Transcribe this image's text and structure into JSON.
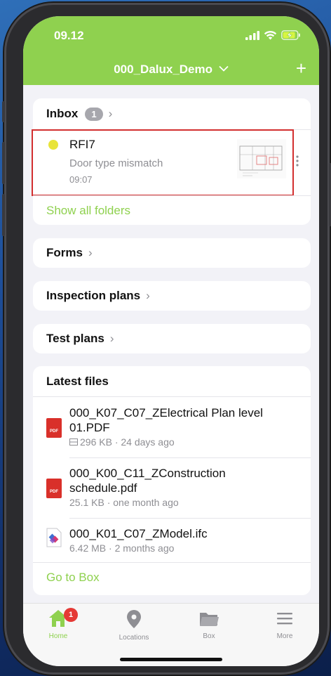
{
  "status": {
    "time": "09.12"
  },
  "header": {
    "project": "000_Dalux_Demo",
    "add_label": "+"
  },
  "inbox": {
    "title": "Inbox",
    "count": "1",
    "item": {
      "title": "RFI7",
      "subtitle": "Door type mismatch",
      "time": "09:07"
    },
    "show_all": "Show all folders"
  },
  "sections": {
    "forms": "Forms",
    "inspection_plans": "Inspection plans",
    "test_plans": "Test plans"
  },
  "latest_files": {
    "title": "Latest files",
    "files": [
      {
        "name": "000_K07_C07_ZElectrical Plan level 01.PDF",
        "meta": "296 KB · 24 days ago",
        "type": "pdf-icon"
      },
      {
        "name": "000_K00_C11_ZConstruction schedule.pdf",
        "meta": "25.1 KB · one month ago",
        "type": "pdf-icon"
      },
      {
        "name": "000_K01_C07_ZModel.ifc",
        "meta": "6.42 MB · 2 months ago",
        "type": "ifc-icon"
      }
    ],
    "go_to_box": "Go to Box"
  },
  "tabs": [
    {
      "label": "Home",
      "icon": "home-icon",
      "badge": "1"
    },
    {
      "label": "Locations",
      "icon": "location-pin-icon"
    },
    {
      "label": "Box",
      "icon": "folder-icon"
    },
    {
      "label": "More",
      "icon": "menu-icon"
    }
  ],
  "colors": {
    "brand": "#8fd14f",
    "highlight_border": "#d32f2f",
    "status_dot": "#e8e43a",
    "tab_badge": "#e53935"
  }
}
